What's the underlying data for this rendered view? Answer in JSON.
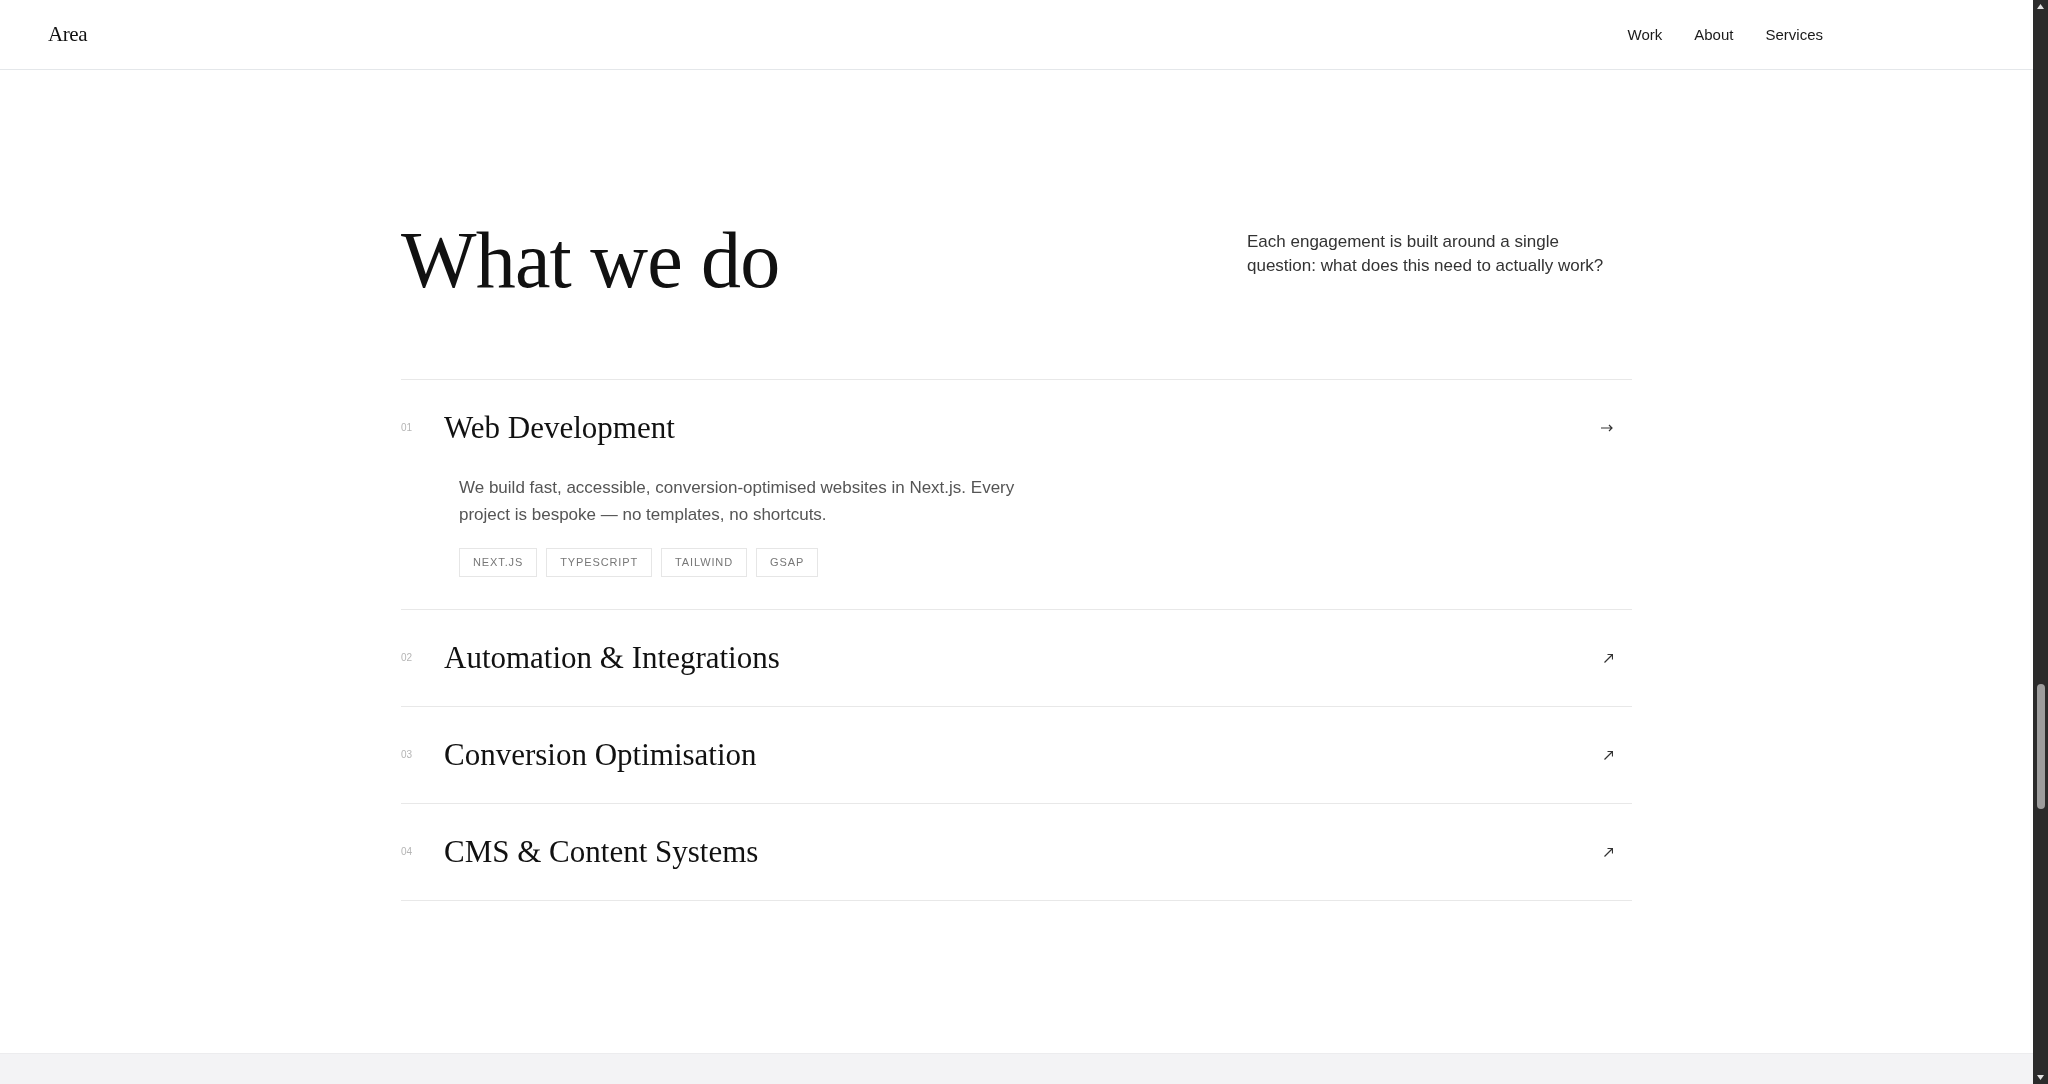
{
  "header": {
    "logo": "Area",
    "nav": [
      {
        "label": "Work"
      },
      {
        "label": "About"
      },
      {
        "label": "Services"
      }
    ]
  },
  "section": {
    "title": "What we do",
    "intro": "Each engagement is built around a single question: what does this need to actually work?",
    "services": [
      {
        "number": "01",
        "title": "Web Development",
        "expanded": true,
        "description": "We build fast, accessible, conversion-optimised websites in Next.js. Every project is bespoke — no templates, no shortcuts.",
        "tags": [
          "NEXT.JS",
          "TYPESCRIPT",
          "TAILWIND",
          "GSAP"
        ]
      },
      {
        "number": "02",
        "title": "Automation & Integrations",
        "expanded": false
      },
      {
        "number": "03",
        "title": "Conversion Optimisation",
        "expanded": false
      },
      {
        "number": "04",
        "title": "CMS & Content Systems",
        "expanded": false
      }
    ]
  }
}
